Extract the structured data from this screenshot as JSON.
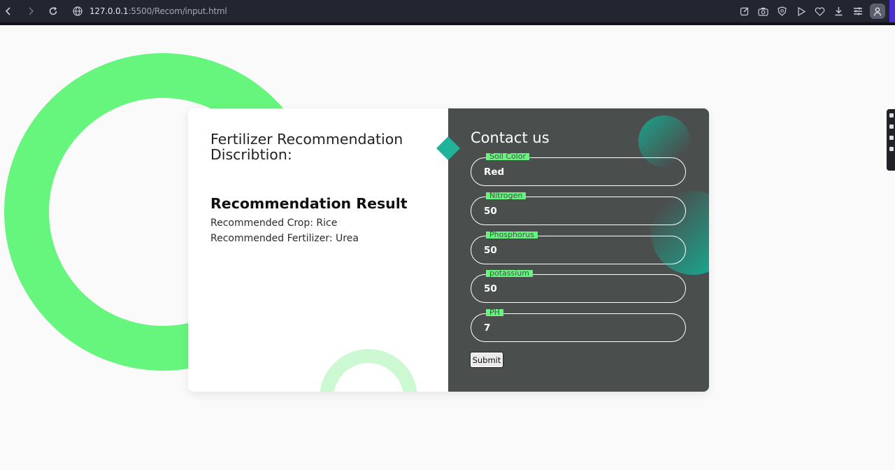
{
  "browser": {
    "url_host": "127.0.0.1",
    "url_rest": ":5500/Recom/input.html"
  },
  "left_panel": {
    "title": "Fertilizer Recommendation Discribtion:",
    "result_heading": "Recommendation Result",
    "recommended_crop": "Recommended Crop: Rice",
    "recommended_fertilizer": "Recommended Fertilizer: Urea"
  },
  "right_panel": {
    "title": "Contact us",
    "fields": [
      {
        "label": "Soil Color",
        "value": "Red"
      },
      {
        "label": "Nitrogen",
        "value": "50"
      },
      {
        "label": "Phosphorus",
        "value": "50"
      },
      {
        "label": "potassium",
        "value": "50"
      },
      {
        "label": "PH",
        "value": "7"
      }
    ],
    "submit_label": "Submit"
  },
  "colors": {
    "accent_green": "#66f57d",
    "panel_dark": "#4a4f4e",
    "teal": "#1fb49a"
  }
}
